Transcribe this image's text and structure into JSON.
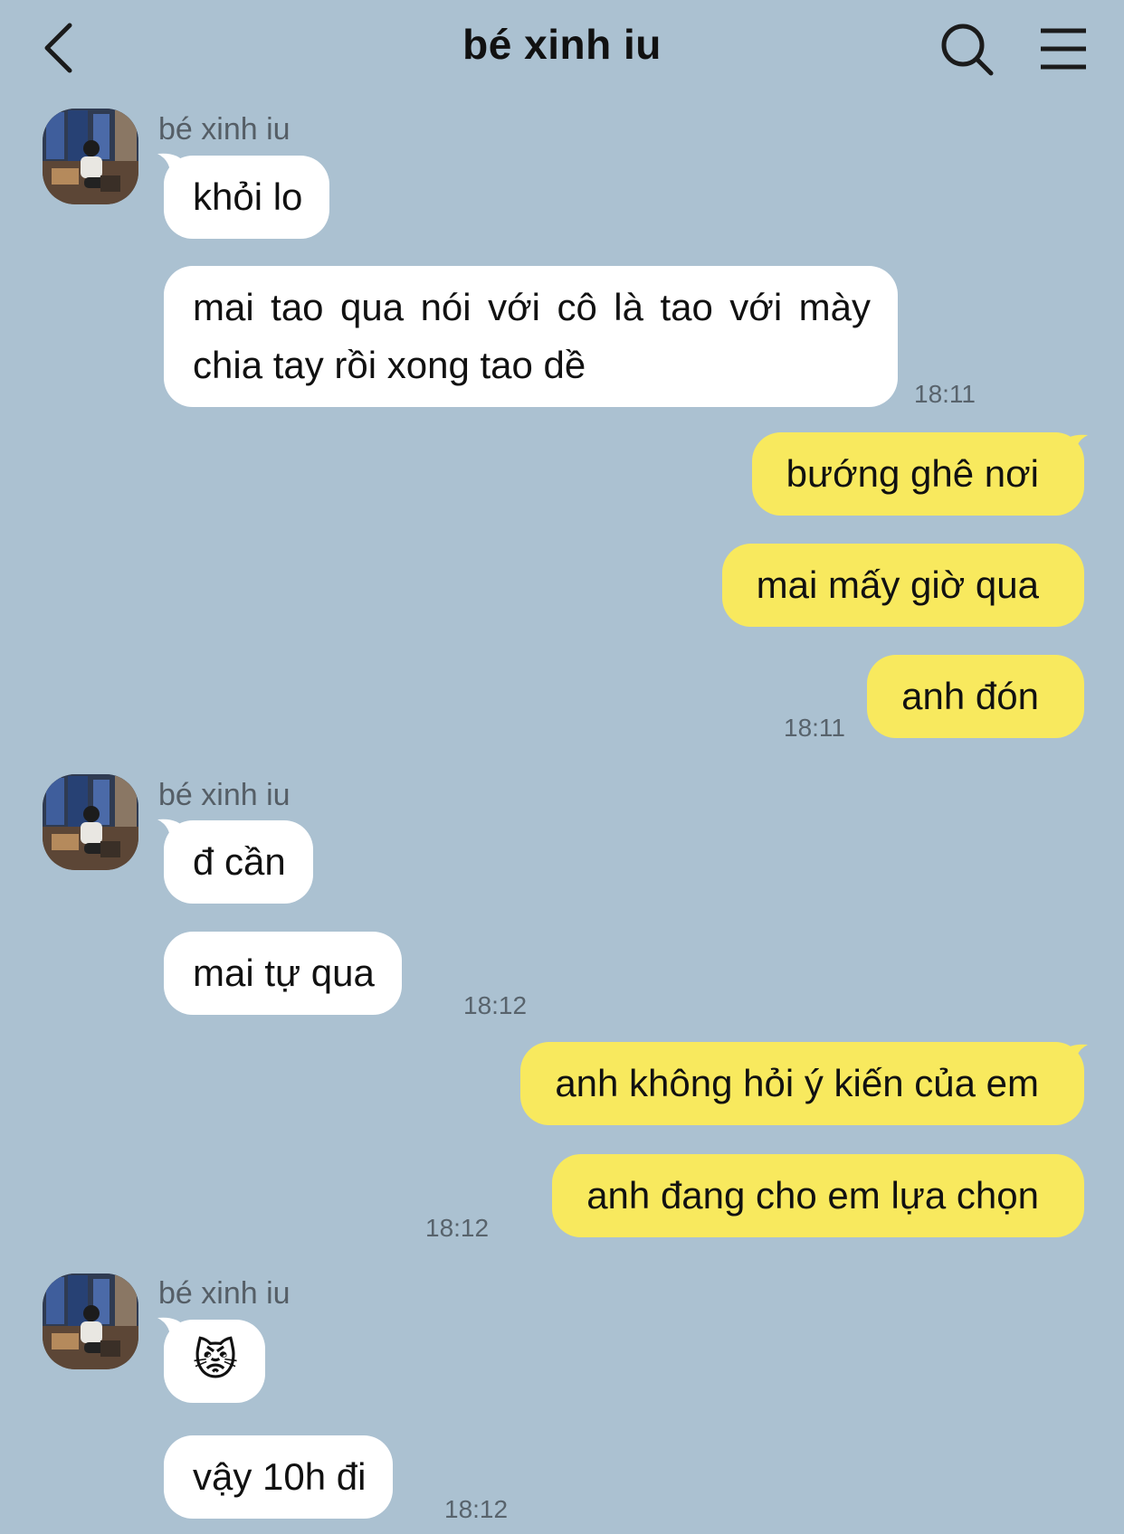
{
  "header": {
    "title": "bé xinh iu",
    "icons": [
      "back-arrow-icon",
      "search-icon",
      "menu-icon"
    ]
  },
  "contact": {
    "name": "bé xinh iu"
  },
  "messages": [
    {
      "from": "them",
      "text": "khỏi lo"
    },
    {
      "from": "them",
      "text": "mai tao qua nói với cô là tao với mày chia tay rồi xong tao dề",
      "time": "18:11"
    },
    {
      "from": "me",
      "text": "bướng ghê nơi"
    },
    {
      "from": "me",
      "text": "mai mấy giờ qua"
    },
    {
      "from": "me",
      "text": "anh đón",
      "time": "18:11"
    },
    {
      "from": "them",
      "text": "đ cần"
    },
    {
      "from": "them",
      "text": "mai tự qua",
      "time": "18:12"
    },
    {
      "from": "me",
      "text": "anh không hỏi ý kiến của em"
    },
    {
      "from": "me",
      "text": "anh đang cho em lựa chọn",
      "time": "18:12"
    },
    {
      "from": "them",
      "text": "😾"
    },
    {
      "from": "them",
      "text": "vậy 10h đi",
      "time": "18:12"
    }
  ],
  "colors": {
    "background": "#abc1d1",
    "incoming_bubble": "#ffffff",
    "outgoing_bubble": "#f8e95e"
  }
}
